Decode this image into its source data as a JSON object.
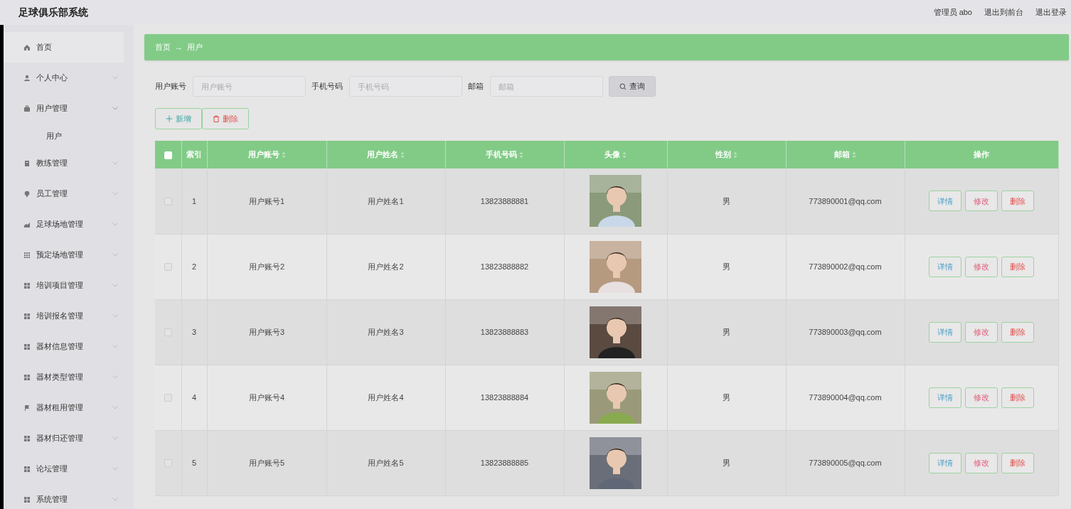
{
  "header": {
    "title": "足球俱乐部系统",
    "links": [
      "管理员 abo",
      "退出到前台",
      "退出登录"
    ]
  },
  "sidebar": {
    "items": [
      {
        "label": "首页",
        "kind": "link",
        "selected": true
      },
      {
        "label": "个人中心",
        "kind": "submenu",
        "expanded": false,
        "selected": false
      },
      {
        "label": "用户管理",
        "kind": "submenu",
        "expanded": true,
        "selected": false,
        "children": [
          {
            "label": "用户",
            "selected": false
          }
        ]
      },
      {
        "label": "教练管理",
        "kind": "submenu",
        "expanded": false,
        "selected": false
      },
      {
        "label": "员工管理",
        "kind": "submenu",
        "expanded": false,
        "selected": false
      },
      {
        "label": "足球场地管理",
        "kind": "submenu",
        "expanded": false,
        "selected": false
      },
      {
        "label": "预定场地管理",
        "kind": "submenu",
        "expanded": false,
        "selected": false
      },
      {
        "label": "培训项目管理",
        "kind": "submenu",
        "expanded": false,
        "selected": false
      },
      {
        "label": "培训报名管理",
        "kind": "submenu",
        "expanded": false,
        "selected": false
      },
      {
        "label": "器材信息管理",
        "kind": "submenu",
        "expanded": false,
        "selected": false
      },
      {
        "label": "器材类型管理",
        "kind": "submenu",
        "expanded": false,
        "selected": false
      },
      {
        "label": "器材租用管理",
        "kind": "submenu",
        "expanded": false,
        "selected": false
      },
      {
        "label": "器材归还管理",
        "kind": "submenu",
        "expanded": false,
        "selected": false
      },
      {
        "label": "论坛管理",
        "kind": "submenu",
        "expanded": false,
        "selected": false
      },
      {
        "label": "系统管理",
        "kind": "submenu",
        "expanded": false,
        "selected": false
      }
    ]
  },
  "breadcrumb": [
    "首页",
    "→",
    "用户"
  ],
  "search": {
    "fields": [
      {
        "label": "用户账号",
        "placeholder": "用户账号"
      },
      {
        "label": "手机号码",
        "placeholder": "手机号码"
      },
      {
        "label": "邮箱",
        "placeholder": "邮箱"
      }
    ],
    "button": "查询"
  },
  "actions": [
    {
      "label": "新增",
      "kind": "add"
    },
    {
      "label": "删除",
      "kind": "delete"
    }
  ],
  "table": {
    "select_all": {
      "checked": false
    },
    "columns": [
      {
        "label": "索引",
        "sortable": false
      },
      {
        "label": "用户账号",
        "sortable": true
      },
      {
        "label": "用户姓名",
        "sortable": true
      },
      {
        "label": "手机号码",
        "sortable": true
      },
      {
        "label": "头像",
        "sortable": true
      },
      {
        "label": "性别",
        "sortable": true
      },
      {
        "label": "邮箱",
        "sortable": true
      },
      {
        "label": "操作",
        "sortable": false
      }
    ],
    "rows": [
      {
        "checked": false,
        "index": "1",
        "account": "用户账号1",
        "name": "用户姓名1",
        "phone": "13823888881",
        "gender": "男",
        "email": "773890001@qq.com",
        "buttons": [
          "详情",
          "修改",
          "删除"
        ]
      },
      {
        "checked": false,
        "index": "2",
        "account": "用户账号2",
        "name": "用户姓名2",
        "phone": "13823888882",
        "gender": "男",
        "email": "773890002@qq.com",
        "buttons": [
          "详情",
          "修改",
          "删除"
        ]
      },
      {
        "checked": false,
        "index": "3",
        "account": "用户账号3",
        "name": "用户姓名3",
        "phone": "13823888883",
        "gender": "男",
        "email": "773890003@qq.com",
        "buttons": [
          "详情",
          "修改",
          "删除"
        ]
      },
      {
        "checked": false,
        "index": "4",
        "account": "用户账号4",
        "name": "用户姓名4",
        "phone": "13823888884",
        "gender": "男",
        "email": "773890004@qq.com",
        "buttons": [
          "详情",
          "修改",
          "删除"
        ]
      },
      {
        "checked": false,
        "index": "5",
        "account": "用户账号5",
        "name": "用户姓名5",
        "phone": "13823888885",
        "gender": "男",
        "email": "773890005@qq.com",
        "buttons": [
          "详情",
          "修改",
          "删除"
        ]
      }
    ]
  }
}
